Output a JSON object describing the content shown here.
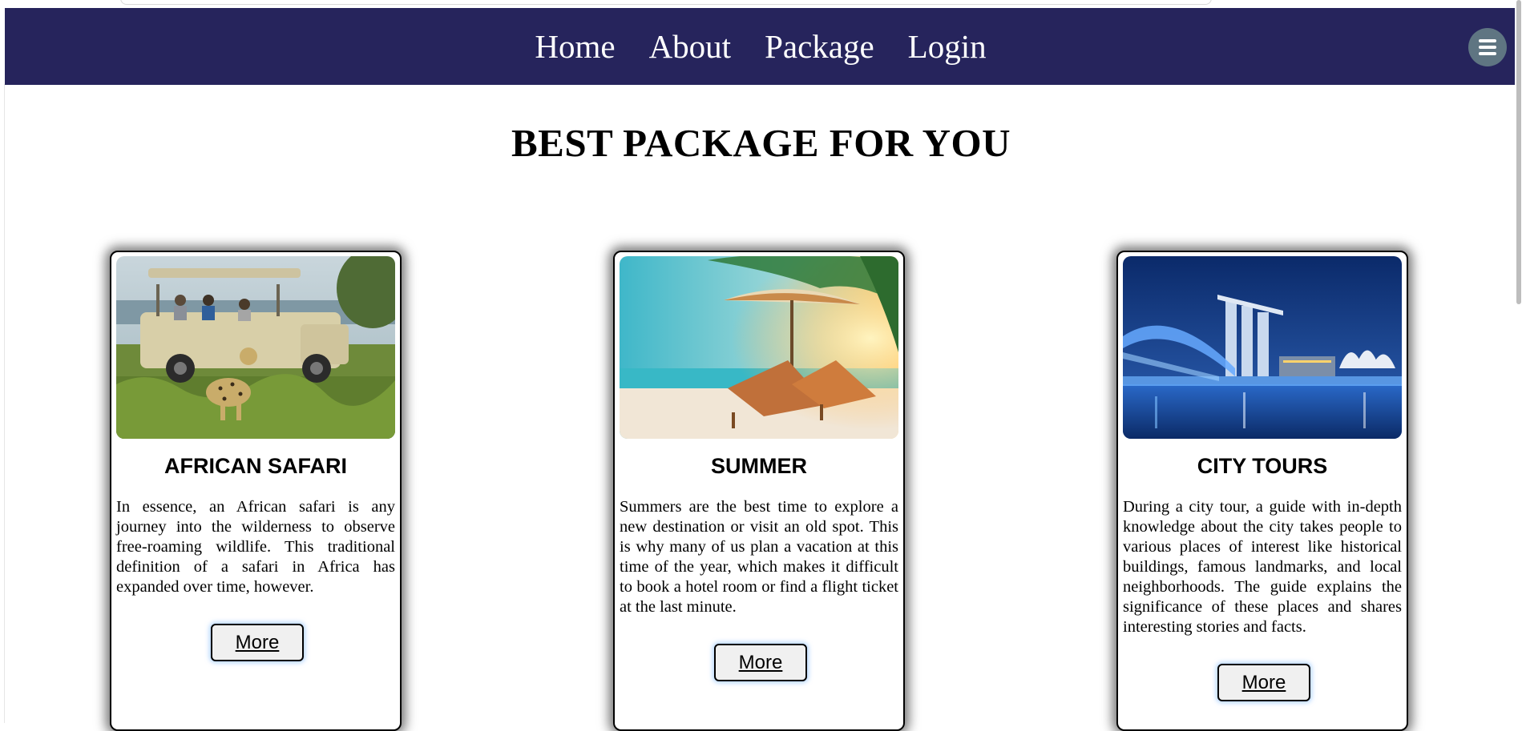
{
  "nav": {
    "links": [
      "Home",
      "About",
      "Package",
      "Login"
    ],
    "menu_icon": "hamburger-icon",
    "background": "#26245c"
  },
  "page": {
    "heading": "BEST PACKAGE FOR YOU"
  },
  "cards": [
    {
      "title": "AFRICAN SAFARI",
      "description": "In essence, an African safari is any journey into the wilderness to observe free-roaming wildlife. This traditional definition of a safari in Africa has expanded over time, however.",
      "button": "More",
      "image": "safari-jeep-leopard-image"
    },
    {
      "title": "SUMMER",
      "description": "Summers are the best time to explore a new destination or visit an old spot. This is why many of us plan a vacation at this time of the year, which makes it difficult to book a hotel room or find a flight ticket at the last minute.",
      "button": "More",
      "image": "beach-umbrella-loungers-image"
    },
    {
      "title": "CITY TOURS",
      "description": "During a city tour, a guide with in-depth knowledge about the city takes people to various places of interest like historical buildings, famous landmarks, and local neighborhoods. The guide explains the significance of these places and shares interesting stories and facts.",
      "button": "More",
      "image": "city-skyline-night-image"
    }
  ]
}
